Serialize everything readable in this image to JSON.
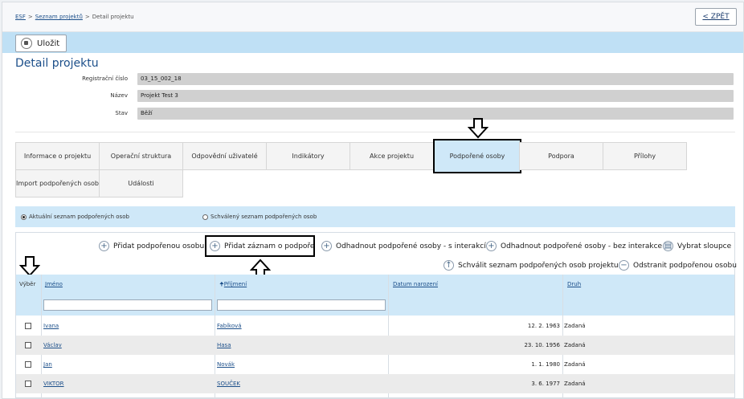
{
  "breadcrumb": {
    "home": "ESF",
    "projects": "Seznam projektů",
    "current": "Detail projektu"
  },
  "back_label": "< ZPĚT",
  "toolbar": {
    "save_label": "Uložit"
  },
  "page_title": "Detail projektu",
  "form": {
    "reg_label": "Registrační číslo",
    "reg_value": "03_15_002_18",
    "name_label": "Název",
    "name_value": "Projekt Test 3",
    "state_label": "Stav",
    "state_value": "Běží"
  },
  "tabs": [
    "Informace o projektu",
    "Operační struktura",
    "Odpovědní uživatelé",
    "Indikátory",
    "Akce projektu",
    "Podpořené osoby",
    "Podpora",
    "Přílohy",
    "Import podpořených osob",
    "Události"
  ],
  "radios": {
    "current": "Aktuální seznam podpořených osob",
    "approved": "Schválený seznam podpořených osob"
  },
  "actions": {
    "add_person": "Přidat podpořenou osobu",
    "add_record": "Přidat záznam o podpoře",
    "estimate_with": "Odhadnout podpořené osoby - s interakcí",
    "estimate_without": "Odhadnout podpořené osoby - bez interakce",
    "select_columns": "Vybrat sloupce",
    "approve_list": "Schválit seznam podpořených osob projektu",
    "remove_person": "Odstranit podpořenou osobu"
  },
  "table": {
    "headers": {
      "select": "Výběr",
      "first": "Jméno",
      "last": "Příjmení",
      "birth": "Datum narození",
      "kind": "Druh"
    },
    "rows": [
      {
        "first": "Ivana",
        "last": "Fabíková",
        "birth": "12. 2. 1963",
        "kind": "Zadaná"
      },
      {
        "first": "Václav",
        "last": "Hasa",
        "birth": "23. 10. 1956",
        "kind": "Zadaná"
      },
      {
        "first": "Jan",
        "last": "Novák",
        "birth": "1. 1. 1980",
        "kind": "Zadaná"
      },
      {
        "first": "VIKTOR",
        "last": "SOUČEK",
        "birth": "3. 6. 1977",
        "kind": "Zadaná"
      }
    ]
  },
  "colors": {
    "accent_light": "#cfe8f8",
    "toolbar": "#bfe0f5",
    "link": "#1c4f8a"
  }
}
